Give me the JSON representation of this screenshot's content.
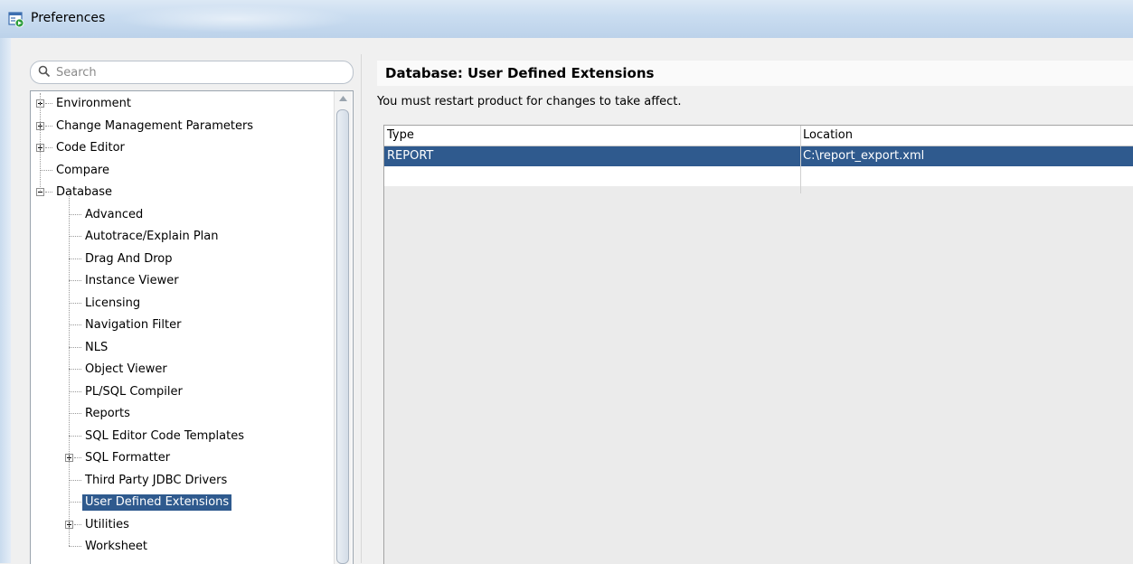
{
  "window": {
    "title": "Preferences"
  },
  "search": {
    "placeholder": "Search",
    "value": ""
  },
  "tree": {
    "items": [
      {
        "label": "Environment",
        "expander": "plus",
        "level": 0
      },
      {
        "label": "Change Management Parameters",
        "expander": "plus",
        "level": 0
      },
      {
        "label": "Code Editor",
        "expander": "plus",
        "level": 0
      },
      {
        "label": "Compare",
        "expander": "none",
        "level": 0
      },
      {
        "label": "Database",
        "expander": "minus",
        "level": 0
      },
      {
        "label": "Advanced",
        "expander": "none",
        "level": 1
      },
      {
        "label": "Autotrace/Explain Plan",
        "expander": "none",
        "level": 1
      },
      {
        "label": "Drag And Drop",
        "expander": "none",
        "level": 1
      },
      {
        "label": "Instance Viewer",
        "expander": "none",
        "level": 1
      },
      {
        "label": "Licensing",
        "expander": "none",
        "level": 1
      },
      {
        "label": "Navigation Filter",
        "expander": "none",
        "level": 1
      },
      {
        "label": "NLS",
        "expander": "none",
        "level": 1
      },
      {
        "label": "Object Viewer",
        "expander": "none",
        "level": 1
      },
      {
        "label": "PL/SQL Compiler",
        "expander": "none",
        "level": 1
      },
      {
        "label": "Reports",
        "expander": "none",
        "level": 1
      },
      {
        "label": "SQL Editor Code Templates",
        "expander": "none",
        "level": 1
      },
      {
        "label": "SQL Formatter",
        "expander": "plus",
        "level": 1
      },
      {
        "label": "Third Party JDBC Drivers",
        "expander": "none",
        "level": 1
      },
      {
        "label": "User Defined Extensions",
        "expander": "none",
        "level": 1,
        "selected": true
      },
      {
        "label": "Utilities",
        "expander": "plus",
        "level": 1
      },
      {
        "label": "Worksheet",
        "expander": "none",
        "level": 1
      }
    ]
  },
  "main": {
    "heading": "Database: User Defined Extensions",
    "notice": "You must restart product for changes to take affect.",
    "table": {
      "columns": [
        "Type",
        "Location"
      ],
      "rows": [
        [
          "REPORT",
          "C:\\report_export.xml"
        ],
        [
          "",
          ""
        ]
      ]
    }
  },
  "colors": {
    "selection": "#2f5a8e",
    "title_bar": "#c9dcf0"
  }
}
